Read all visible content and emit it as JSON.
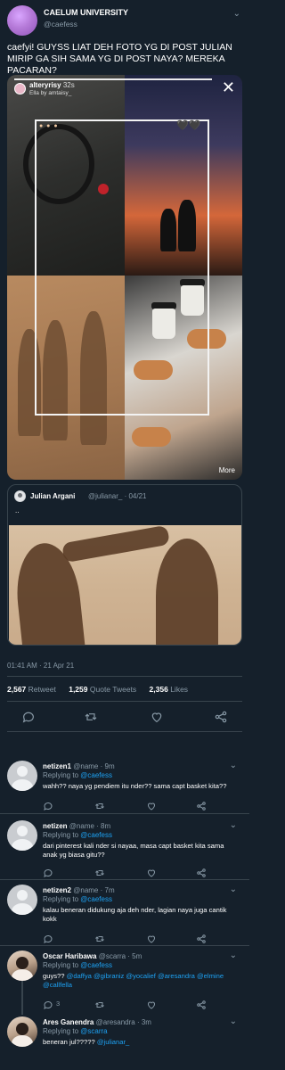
{
  "tweet": {
    "name": "CAELUM UNIVERSITY",
    "handle": "@caefess",
    "text": "caefyi! GUYSS LIAT DEH FOTO YG DI POST JULIAN MIRIP GA SIH SAMA YG DI POST NAYA? MEREKA PACARAN?",
    "time": "01:41 AM · 21 Apr 21",
    "stats": {
      "retweets": "2,567",
      "retweets_label": "Retweet",
      "quotes": "1,259",
      "quotes_label": "Quote Tweets",
      "likes": "2,356",
      "likes_label": "Likes"
    }
  },
  "media": {
    "story_user": "alteryrisy",
    "story_time": "32s",
    "story_sub": "Ella by amtaisy_",
    "close_glyph": "✕",
    "overlay_dots": "● ● ●",
    "overlay_hearts": "🖤🖤",
    "more_label": "More"
  },
  "quote": {
    "name": "Julian Argani",
    "handle": "@julianar_ · 04/21",
    "text": ".."
  },
  "replies": [
    {
      "name": "netizen1",
      "handle": "@name · 9m",
      "replying_label": "Replying to",
      "replying_to": "@caefess",
      "body": "wahh?? naya yg pendiem itu nder?? sama capt basket kita??"
    },
    {
      "name": "netizen",
      "handle": "@name · 8m",
      "replying_label": "Replying to",
      "replying_to": "@caefess",
      "body": "dari pinterest kali nder si nayaa, masa capt basket kita sama anak yg biasa gitu??"
    },
    {
      "name": "netizen2",
      "handle": "@name · 7m",
      "replying_label": "Replying to",
      "replying_to": "@caefess",
      "body": "kalau beneran didukung aja deh nder, lagian naya juga cantik kokk"
    },
    {
      "name": "Oscar Haribawa",
      "handle": "@scarra · 5m",
      "replying_label": "Replying to",
      "replying_to": "@caefess",
      "body_prefix": "guys?? ",
      "mentions": "@daffya @gibraniz @yocalief @aresandra @elmine @callfella",
      "reply_count": "3"
    },
    {
      "name": "Ares Ganendra",
      "handle": "@aresandra · 3m",
      "replying_label": "Replying to",
      "replying_to": "@scarra",
      "body_prefix": "beneran jul????? ",
      "mentions": "@julianar_"
    }
  ],
  "icons": [
    "reply-icon",
    "retweet-icon",
    "like-icon",
    "share-icon",
    "chevron-down-icon"
  ],
  "colors": {
    "background": "#15202b",
    "link": "#1da1f2",
    "muted": "#8899a6",
    "divider": "#38444d"
  }
}
